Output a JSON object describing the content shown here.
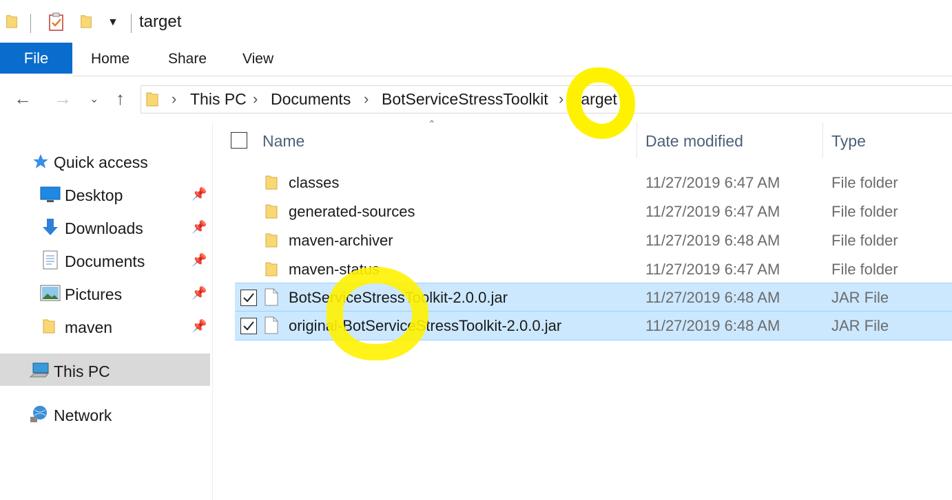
{
  "window": {
    "title": "target"
  },
  "ribbon": {
    "file": "File",
    "tabs": [
      "Home",
      "Share",
      "View"
    ]
  },
  "address": {
    "crumbs": [
      "This PC",
      "Documents",
      "BotServiceStressToolkit",
      "target"
    ]
  },
  "columns": {
    "name": "Name",
    "date": "Date modified",
    "type": "Type"
  },
  "files": [
    {
      "name": "classes",
      "date": "11/27/2019 6:47 AM",
      "type": "File folder",
      "kind": "folder",
      "selected": false
    },
    {
      "name": "generated-sources",
      "date": "11/27/2019 6:47 AM",
      "type": "File folder",
      "kind": "folder",
      "selected": false
    },
    {
      "name": "maven-archiver",
      "date": "11/27/2019 6:48 AM",
      "type": "File folder",
      "kind": "folder",
      "selected": false
    },
    {
      "name": "maven-status",
      "date": "11/27/2019 6:47 AM",
      "type": "File folder",
      "kind": "folder",
      "selected": false
    },
    {
      "name": "BotServiceStressToolkit-2.0.0.jar",
      "date": "11/27/2019 6:48 AM",
      "type": "JAR File",
      "kind": "file",
      "selected": true
    },
    {
      "name": "original-BotServiceStressToolkit-2.0.0.jar",
      "date": "11/27/2019 6:48 AM",
      "type": "JAR File",
      "kind": "file",
      "selected": true
    }
  ],
  "nav": {
    "quick_access": "Quick access",
    "items": [
      "Desktop",
      "Downloads",
      "Documents",
      "Pictures",
      "maven"
    ],
    "this_pc": "This PC",
    "network": "Network"
  },
  "icons": {
    "folder": "folder-icon",
    "file": "file-icon",
    "pin": "pin-icon",
    "star": "star-icon"
  },
  "colors": {
    "accent": "#0a6ccc",
    "selection": "#cce8ff",
    "highlight": "#fff200"
  }
}
